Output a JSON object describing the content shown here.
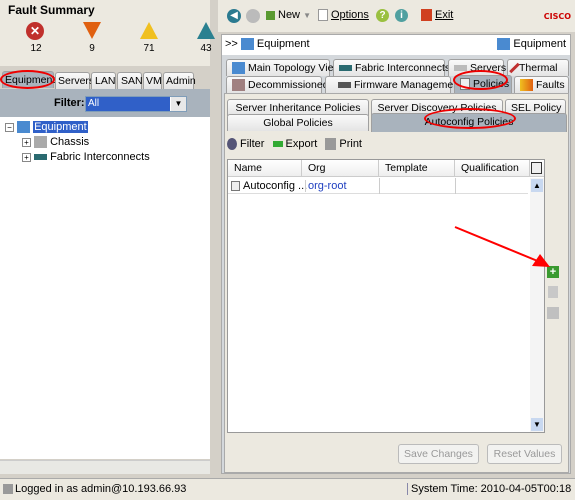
{
  "fault_summary": {
    "title": "Fault Summary",
    "counts": [
      {
        "icon": "critical-icon",
        "value": "12",
        "color": "#c0302c"
      },
      {
        "icon": "major-icon",
        "value": "9",
        "color": "#e06010"
      },
      {
        "icon": "minor-icon",
        "value": "71",
        "color": "#f0c020"
      },
      {
        "icon": "warning-icon",
        "value": "43",
        "color": "#2a8090"
      }
    ]
  },
  "nav_tabs": [
    "Equipment",
    "Servers",
    "LAN",
    "SAN",
    "VM",
    "Admin"
  ],
  "filter": {
    "label": "Filter:",
    "value": "All"
  },
  "tree": {
    "root": "Equipment",
    "children": [
      "Chassis",
      "Fabric Interconnects"
    ]
  },
  "toolbar": {
    "new": "New",
    "options": "Options",
    "exit": "Exit",
    "brand": "cisco"
  },
  "breadcrumb": {
    "prefix": ">>",
    "path": "Equipment",
    "right": "Equipment"
  },
  "main_tabs_row1": [
    "Main Topology View",
    "Fabric Interconnects",
    "Servers",
    "Thermal"
  ],
  "main_tabs_row2": [
    "Decommissioned",
    "Firmware Management",
    "Policies",
    "Faults"
  ],
  "sub_tabs_row1": [
    "Server Inheritance Policies",
    "Server Discovery Policies",
    "SEL Policy"
  ],
  "sub_tabs_row2": [
    "Global Policies",
    "Autoconfig Policies"
  ],
  "table_toolbar": {
    "filter": "Filter",
    "export": "Export",
    "print": "Print"
  },
  "table": {
    "columns": [
      "Name",
      "Org",
      "Template",
      "Qualification"
    ],
    "rows": [
      [
        "Autoconfig ...",
        "org-root",
        "",
        ""
      ]
    ]
  },
  "buttons": {
    "save": "Save Changes",
    "reset": "Reset Values"
  },
  "status": {
    "login": "Logged in as admin@10.193.66.93",
    "time": "System Time: 2010-04-05T00:18"
  }
}
